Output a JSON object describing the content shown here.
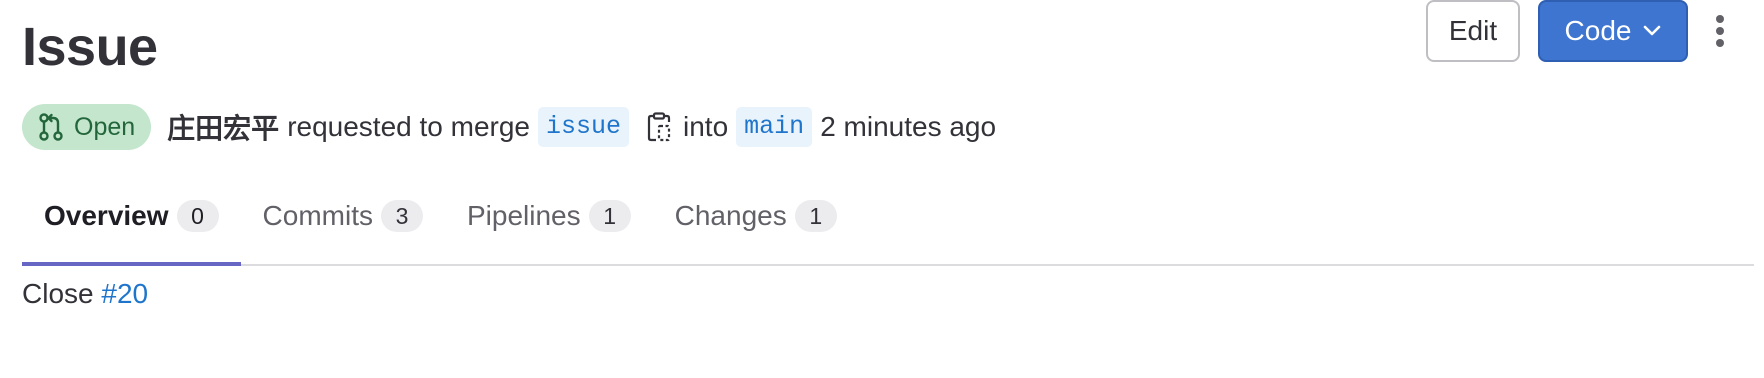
{
  "header": {
    "title": "Issue",
    "edit_label": "Edit",
    "code_label": "Code",
    "code_icon": "chevron-down-icon",
    "more_icon": "kebab-vertical-icon"
  },
  "merge_request": {
    "status": "Open",
    "status_icon": "merge-request-icon",
    "author": "庄田宏平",
    "action_text": "requested to merge",
    "source_branch": "issue",
    "copy_icon": "copy-to-clipboard-icon",
    "into_text": "into",
    "target_branch": "main",
    "time": "2 minutes ago"
  },
  "tabs": [
    {
      "label": "Overview",
      "count": "0",
      "active": true
    },
    {
      "label": "Commits",
      "count": "3",
      "active": false
    },
    {
      "label": "Pipelines",
      "count": "1",
      "active": false
    },
    {
      "label": "Changes",
      "count": "1",
      "active": false
    }
  ],
  "description": {
    "text": "Close",
    "issue_link": "#20"
  },
  "colors": {
    "accent": "#3d75d0",
    "open_badge_bg": "#c3e6cd",
    "open_badge_text": "#24663b",
    "link": "#1f75cb",
    "active_tab_underline": "#6666c4"
  }
}
